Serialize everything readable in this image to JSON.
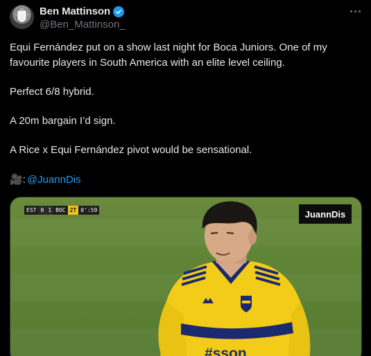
{
  "tweet": {
    "author": {
      "display_name": "Ben Mattinson",
      "handle": "@Ben_Mattinson_",
      "verified": true
    },
    "text": {
      "p1": "Equi Fernández put on a show last night for Boca Juniors. One of my favourite players in South America with an elite level ceiling.",
      "p2": "Perfect 6/8 hybrid.",
      "p3": "A 20m bargain I’d sign.",
      "p4": "A Rice x Equi Fernández pivot would be sensational.",
      "credit_emoji": "🎥:",
      "credit_mention": "@JuannDis"
    },
    "media": {
      "watermark": "JuannDis",
      "scorebug": {
        "home": "EST",
        "home_score": "0",
        "away_score": "1",
        "away": "BOC",
        "period": "2T",
        "clock": "0':59"
      },
      "sponsor_text": "#sson"
    }
  },
  "colors": {
    "background": "#000000",
    "text": "#e7e9ea",
    "secondary": "#71767b",
    "link": "#1d9bf0",
    "verified": "#1d9bf0"
  }
}
